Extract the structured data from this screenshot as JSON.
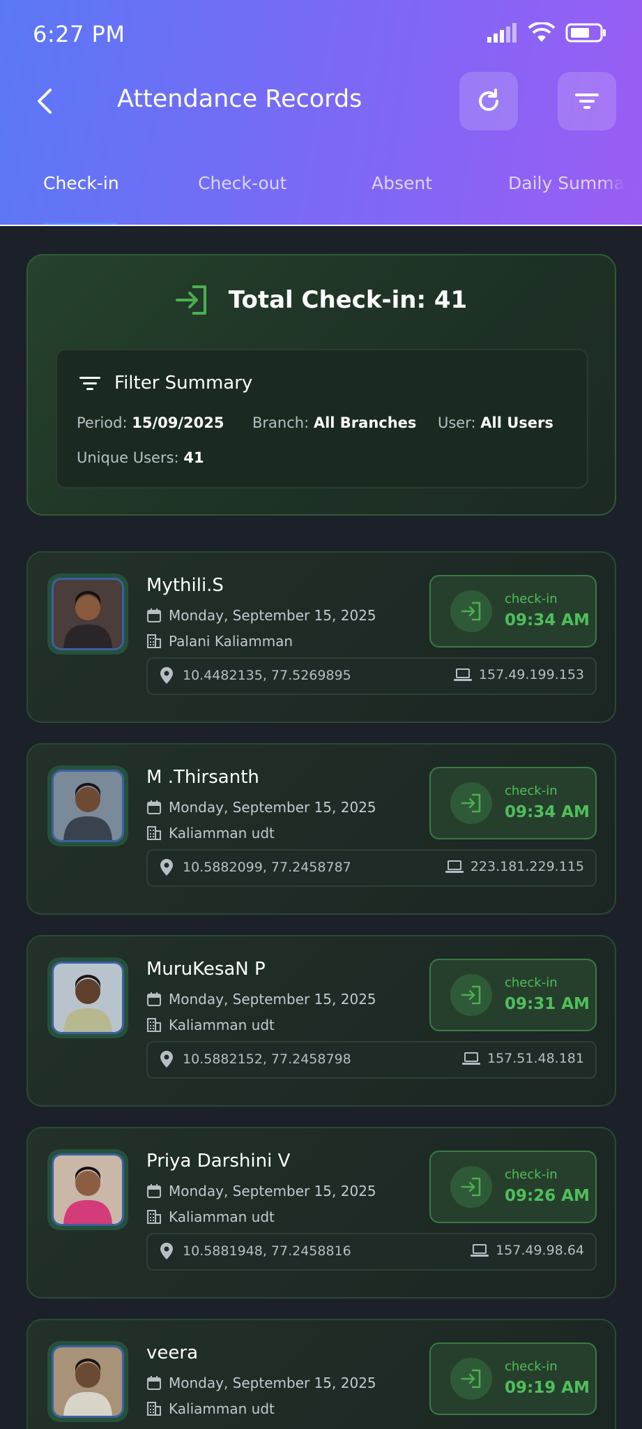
{
  "status_bar": {
    "time": "6:27 PM"
  },
  "header": {
    "title": "Attendance Records"
  },
  "tabs": [
    {
      "label": "Check-in"
    },
    {
      "label": "Check-out"
    },
    {
      "label": "Absent"
    },
    {
      "label": "Daily Summa"
    }
  ],
  "summary": {
    "total": "Total Check-in: 41",
    "filter_title": "Filter Summary",
    "period_label": "Period:",
    "period_value": "15/09/2025",
    "branch_label": "Branch:",
    "branch_value": "All Branches",
    "user_label": "User:",
    "user_value": "All Users",
    "unique_label": "Unique Users:",
    "unique_value": "41"
  },
  "records": [
    {
      "name": "Mythili.S",
      "date": "Monday, September 15, 2025",
      "branch": "Palani Kaliamman",
      "status": "check-in",
      "time": "09:34 AM",
      "coords": "10.4482135, 77.5269895",
      "ip": "157.49.199.153"
    },
    {
      "name": "M .Thirsanth",
      "date": "Monday, September 15, 2025",
      "branch": "Kaliamman udt",
      "status": "check-in",
      "time": "09:34 AM",
      "coords": "10.5882099, 77.2458787",
      "ip": "223.181.229.115"
    },
    {
      "name": "MuruKesaN P",
      "date": "Monday, September 15, 2025",
      "branch": "Kaliamman udt",
      "status": "check-in",
      "time": "09:31 AM",
      "coords": "10.5882152, 77.2458798",
      "ip": "157.51.48.181"
    },
    {
      "name": "Priya Darshini V",
      "date": "Monday, September 15, 2025",
      "branch": "Kaliamman udt",
      "status": "check-in",
      "time": "09:26 AM",
      "coords": "10.5881948, 77.2458816",
      "ip": "157.49.98.64"
    },
    {
      "name": "veera",
      "date": "Monday, September 15, 2025",
      "branch": "Kaliamman udt",
      "status": "check-in",
      "time": "09:19 AM",
      "coords": "",
      "ip": ""
    }
  ]
}
